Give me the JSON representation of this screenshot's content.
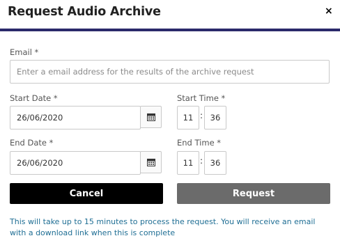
{
  "dialog": {
    "title": "Request Audio Archive",
    "close_glyph": "×"
  },
  "email": {
    "label": "Email *",
    "placeholder": "Enter a email address for the results of the archive request",
    "value": ""
  },
  "start": {
    "date_label": "Start Date *",
    "date_value": "26/06/2020",
    "time_label": "Start Time *",
    "hour": "11",
    "minute": "36"
  },
  "end": {
    "date_label": "End Date *",
    "date_value": "26/06/2020",
    "time_label": "End Time *",
    "hour": "11",
    "minute": "36"
  },
  "time_separator": ":",
  "actions": {
    "cancel_label": "Cancel",
    "request_label": "Request"
  },
  "note": "This will take up to 15 minutes to process the request. You will receive an email with a download link when this is complete",
  "colors": {
    "header_rule": "#2b2a6b",
    "cancel_bg": "#000000",
    "request_bg": "#6b6b6b",
    "note_text": "#1f6e94"
  },
  "icons": {
    "close": "close-icon",
    "calendar": "calendar-icon"
  }
}
